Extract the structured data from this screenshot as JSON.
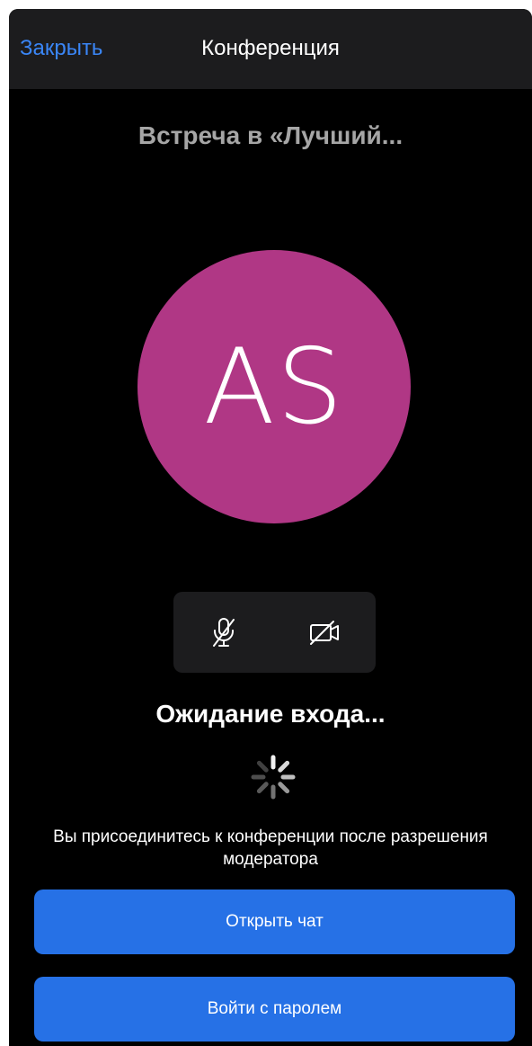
{
  "navbar": {
    "close_label": "Закрыть",
    "title": "Конференция"
  },
  "meeting": {
    "title": "Встреча в «Лучший..."
  },
  "avatar": {
    "initials": "AS",
    "color": "#b03785"
  },
  "controls": {
    "mic_icon": "microphone-off-icon",
    "camera_icon": "camera-off-icon"
  },
  "status": {
    "waiting_text": "Ожидание входа...",
    "spinner_icon": "loading-spinner-icon",
    "info_text": "Вы присоединитесь к конференции после разрешения модератора"
  },
  "actions": {
    "open_chat_label": "Открыть чат",
    "password_login_label": "Войти с паролем"
  },
  "colors": {
    "accent": "#2671e6",
    "link": "#3a86f7",
    "background": "#000000",
    "surface": "#1c1c1e"
  }
}
